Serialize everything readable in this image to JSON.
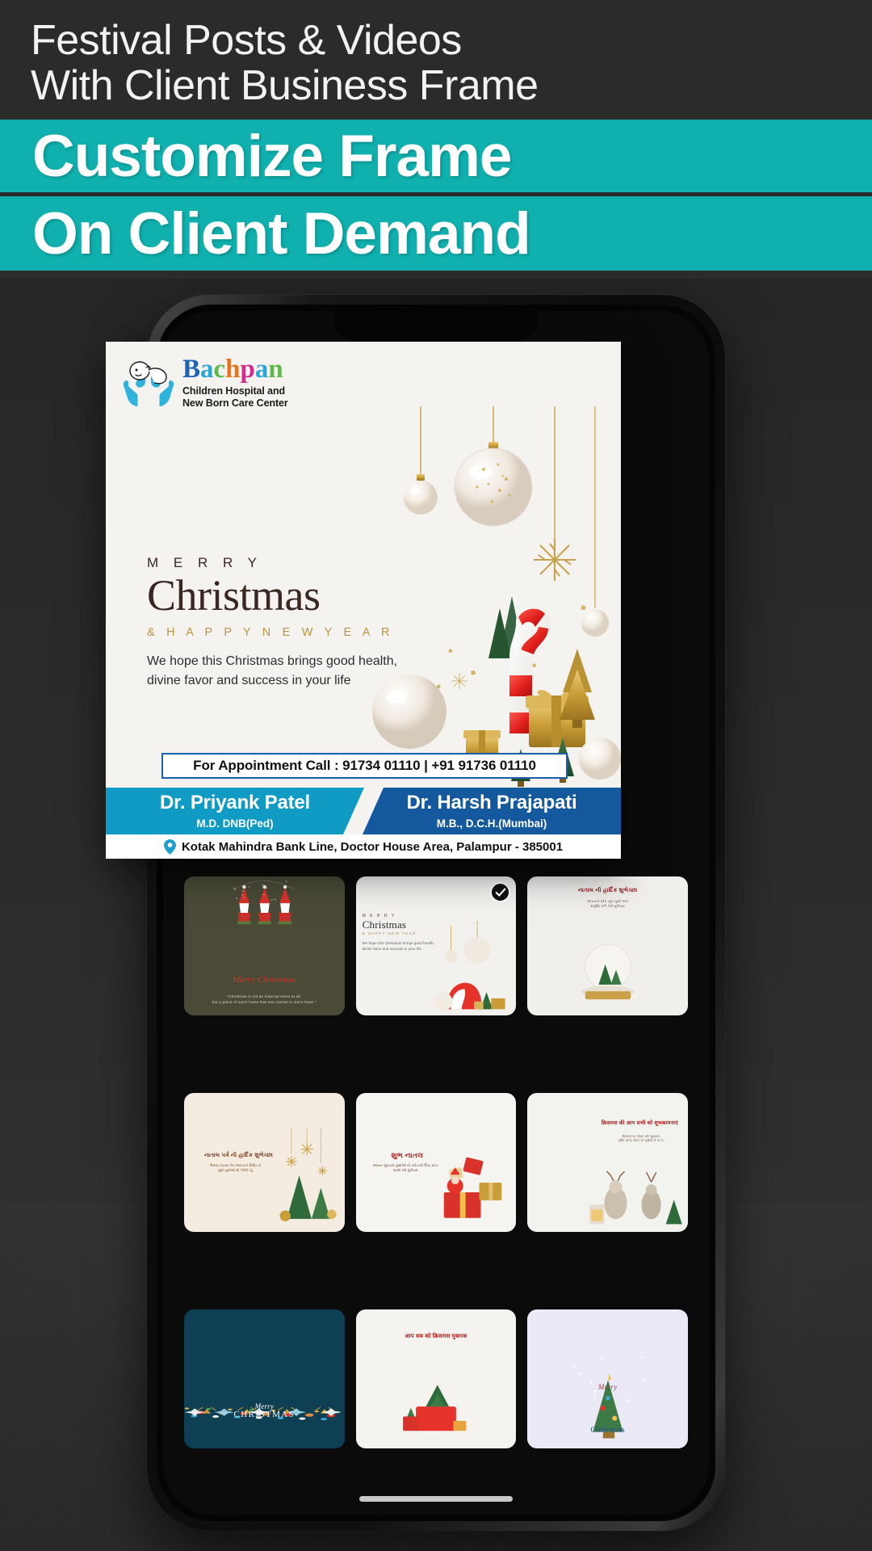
{
  "header": {
    "subtitle_line1": "Festival Posts & Videos",
    "subtitle_line2": "With Client Business Frame",
    "band1": "Customize Frame",
    "band2": "On Client Demand",
    "accent_color": "#0fb0ae",
    "background_color": "#2b2b2b"
  },
  "poster": {
    "logo": {
      "word": "Bachpan",
      "letters": [
        {
          "ch": "B",
          "color": "#1f62b5"
        },
        {
          "ch": "a",
          "color": "#2aa7d8"
        },
        {
          "ch": "c",
          "color": "#5fb84a"
        },
        {
          "ch": "h",
          "color": "#e8751a"
        },
        {
          "ch": "p",
          "color": "#d42b8e"
        },
        {
          "ch": "a",
          "color": "#2aa7d8"
        },
        {
          "ch": "n",
          "color": "#5fb84a"
        }
      ],
      "sub_line1": "Children Hospital and",
      "sub_line2": "New Born Care Center",
      "icon": "baby-in-hands-icon"
    },
    "greeting": {
      "eyebrow": "M E R R Y",
      "title": "Christmas",
      "subtitle": "& H A P P Y  N E W  Y E A R",
      "body_line1": "We hope this Christmas brings good health,",
      "body_line2": "divine favor and success in your life"
    },
    "appointment": "For Appointment Call : 91734 01110 | +91 91736 01110",
    "doctors": [
      {
        "name": "Dr. Priyank Patel",
        "degree": "M.D. DNB(Ped)",
        "color": "#0f9bc4"
      },
      {
        "name": "Dr. Harsh Prajapati",
        "degree": "M.B., D.C.H.(Mumbai)",
        "color": "#14589e"
      }
    ],
    "address": "Kotak Mahindra Bank Line, Doctor House Area, Palampur - 385001",
    "address_icon": "location-pin-icon"
  },
  "gallery": {
    "selected_index": 1,
    "selected_badge_icon": "check-circle-icon",
    "thumbnails": [
      {
        "id": "thumb-gnomes",
        "bg": "#4a4a37",
        "style": "gnomes",
        "title": "Merry Christmas",
        "caption_line1": "\"Christmas is not an external event at all,",
        "caption_line2": "but a piece of one's home that one carries in one's heart.\""
      },
      {
        "id": "thumb-merry-christmas-3d",
        "bg": "#f2f1ee",
        "style": "merry3d",
        "title": "Christmas",
        "eyebrow": "M E R R Y",
        "subtitle": "& HAPPY NEW YEAR",
        "caption_line1": "We hope this Christmas brings good health,",
        "caption_line2": "divine favor and success in your life",
        "selected": true
      },
      {
        "id": "thumb-snowglobe",
        "bg": "#f0efec",
        "style": "snowglobe",
        "title": "નાતાલ ની હાર્દિક શુભેચ્છા",
        "caption_line1": "આપનાને દરેક ખૂબ ખુશી અને",
        "caption_line2": "સમૃદ્ધિ મળે તેવી શુભેચ્છા"
      },
      {
        "id": "thumb-gold-trees",
        "bg": "#f4ece0",
        "style": "goldtrees",
        "title": "નાતાલ પર્વ ની હાર્દિક શુભેચ્છા",
        "caption_line1": "જિસસ ક્રાઇસ્ટ જેવ આવવાની સિદ્ધિ ની",
        "caption_line2": "ખુશી ખુશીઓ થી ભરેલી રહે"
      },
      {
        "id": "thumb-shubh-natal",
        "bg": "#f6f4f1",
        "style": "gifts",
        "title": "શુભ નાતલ",
        "caption_line1": "આપના જીવનમા ખુશીઓ ની નવી નવી ઊંચા પ્રાપ્ત",
        "caption_line2": "થાઓ તેવી શુભેચ્છા"
      },
      {
        "id": "thumb-reindeer",
        "bg": "#f2f2ef",
        "style": "reindeer",
        "title": "क्रिसमस की आप सभी को शुभकामनाएं",
        "caption_line1": "क्रिसमस का त्यौहार और खुशहाल,",
        "caption_line2": "हर्षित आनंद जीवन को खुशियों से भर दे।"
      },
      {
        "id": "thumb-navy-christmas",
        "bg": "#0e3f52",
        "style": "navy",
        "title": "CHRISTMAS",
        "script": "Merry"
      },
      {
        "id": "thumb-red-gift",
        "bg": "#f5f3ef",
        "style": "redgift",
        "title": "आप सब को क्रिसमस मुबारक"
      },
      {
        "id": "thumb-tree-purple",
        "bg": "#ece9f7",
        "style": "purple",
        "title": "Christmas",
        "script": "Merry"
      }
    ]
  }
}
